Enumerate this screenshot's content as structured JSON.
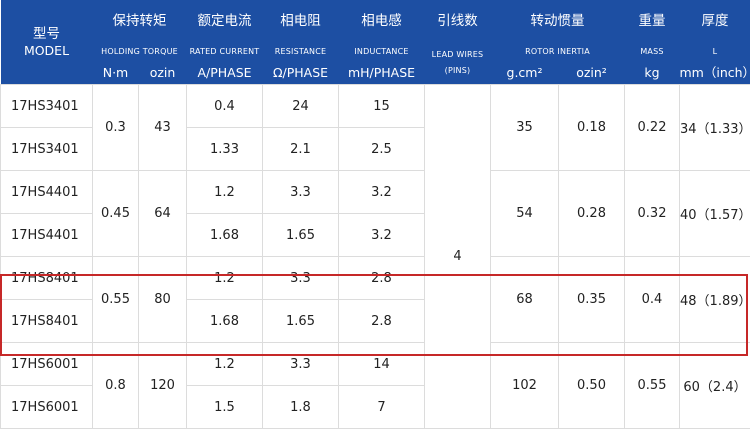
{
  "header": {
    "model_zh": "型号",
    "model_en": "MODEL",
    "torque_zh": "保持转矩",
    "torque_en": "HOLDING TORQUE",
    "torque_unit_nm": "N·m",
    "torque_unit_ozin": "ozin",
    "current_zh": "额定电流",
    "current_en": "RATED CURRENT",
    "current_unit": "A/PHASE",
    "resistance_zh": "相电阻",
    "resistance_en": "RESISTANCE",
    "resistance_unit": "Ω/PHASE",
    "inductance_zh": "相电感",
    "inductance_en": "INDUCTANCE",
    "inductance_unit": "mH/PHASE",
    "leads_zh": "引线数",
    "leads_en": "LEAD WIRES (PINS)",
    "inertia_zh": "转动惯量",
    "inertia_en": "ROTOR INERTIA",
    "inertia_unit_gcm": "g.cm²",
    "inertia_unit_ozin": "ozin²",
    "mass_zh": "重量",
    "mass_en": "MASS",
    "mass_unit": "kg",
    "length_zh": "厚度",
    "length_en": "L",
    "length_unit": "mm（inch）"
  },
  "lead_wires": "4",
  "groups": [
    {
      "torque_nm": "0.3",
      "torque_ozin": "43",
      "inertia_gcm": "35",
      "inertia_ozin": "0.18",
      "mass": "0.22",
      "length": "34（1.33）",
      "rows": [
        {
          "model": "17HS3401",
          "current": "0.4",
          "resistance": "24",
          "inductance": "15"
        },
        {
          "model": "17HS3401",
          "current": "1.33",
          "resistance": "2.1",
          "inductance": "2.5"
        }
      ]
    },
    {
      "torque_nm": "0.45",
      "torque_ozin": "64",
      "inertia_gcm": "54",
      "inertia_ozin": "0.28",
      "mass": "0.32",
      "length": "40（1.57）",
      "rows": [
        {
          "model": "17HS4401",
          "current": "1.2",
          "resistance": "3.3",
          "inductance": "3.2"
        },
        {
          "model": "17HS4401",
          "current": "1.68",
          "resistance": "1.65",
          "inductance": "3.2"
        }
      ]
    },
    {
      "torque_nm": "0.55",
      "torque_ozin": "80",
      "inertia_gcm": "68",
      "inertia_ozin": "0.35",
      "mass": "0.4",
      "length": "48（1.89）",
      "rows": [
        {
          "model": "17HS8401",
          "current": "1.2",
          "resistance": "3.3",
          "inductance": "2.8"
        },
        {
          "model": "17HS8401",
          "current": "1.68",
          "resistance": "1.65",
          "inductance": "2.8"
        }
      ]
    },
    {
      "torque_nm": "0.8",
      "torque_ozin": "120",
      "inertia_gcm": "102",
      "inertia_ozin": "0.50",
      "mass": "0.55",
      "length": "60（2.4）",
      "rows": [
        {
          "model": "17HS6001",
          "current": "1.2",
          "resistance": "3.3",
          "inductance": "14"
        },
        {
          "model": "17HS6001",
          "current": "1.5",
          "resistance": "1.8",
          "inductance": "7"
        }
      ]
    }
  ],
  "colors": {
    "header_bg": "#1d4fa3",
    "highlight_border": "#c62828"
  }
}
